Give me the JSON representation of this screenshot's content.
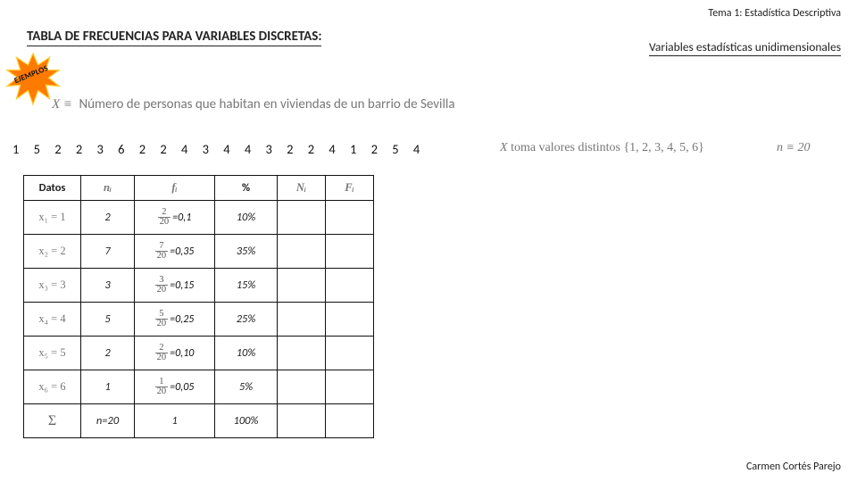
{
  "header": {
    "topic": "Tema 1: Estadística Descriptiva",
    "title": "TABLA DE FRECUENCIAS PARA VARIABLES DISCRETAS:",
    "subtitle": "Variables estadísticas unidimensionales",
    "burst_label": "EJEMPLOS"
  },
  "definition": {
    "symbol": "X ≡",
    "text": "Número de personas que habitan en viviendas de un barrio de Sevilla"
  },
  "raw_data": "1  5  2  2  3  6  2  2  4  3  4  4  3  2  2  4  1  2  5  4",
  "distinct": {
    "label_a": "X",
    "label_b": " toma valores distintos ",
    "set": "{1, 2, 3, 4, 5, 6}"
  },
  "n_stmt": {
    "label": "n ≡ 20"
  },
  "table": {
    "headers": {
      "datos": "Datos",
      "ni": "nᵢ",
      "fi": "fᵢ",
      "pct": "%",
      "Ni": "Nᵢ",
      "Fi": "Fᵢ"
    },
    "rows": [
      {
        "x": "x₁ = 1",
        "n": "2",
        "frac_num": "2",
        "frac_den": "20",
        "fval": "=0,1",
        "pct": "10%"
      },
      {
        "x": "x₂ = 2",
        "n": "7",
        "frac_num": "7",
        "frac_den": "20",
        "fval": "=0,35",
        "pct": "35%"
      },
      {
        "x": "x₃ = 3",
        "n": "3",
        "frac_num": "3",
        "frac_den": "20",
        "fval": "=0,15",
        "pct": "15%"
      },
      {
        "x": "x₄ = 4",
        "n": "5",
        "frac_num": "5",
        "frac_den": "20",
        "fval": "=0,25",
        "pct": "25%"
      },
      {
        "x": "x₅ = 5",
        "n": "2",
        "frac_num": "2",
        "frac_den": "20",
        "fval": "=0,10",
        "pct": "10%"
      },
      {
        "x": "x₆ = 6",
        "n": "1",
        "frac_num": "1",
        "frac_den": "20",
        "fval": "=0,05",
        "pct": "5%"
      }
    ],
    "totals": {
      "sigma": "Σ",
      "n": "n=20",
      "f": "1",
      "pct": "100%"
    }
  },
  "author": "Carmen Cortés Parejo"
}
